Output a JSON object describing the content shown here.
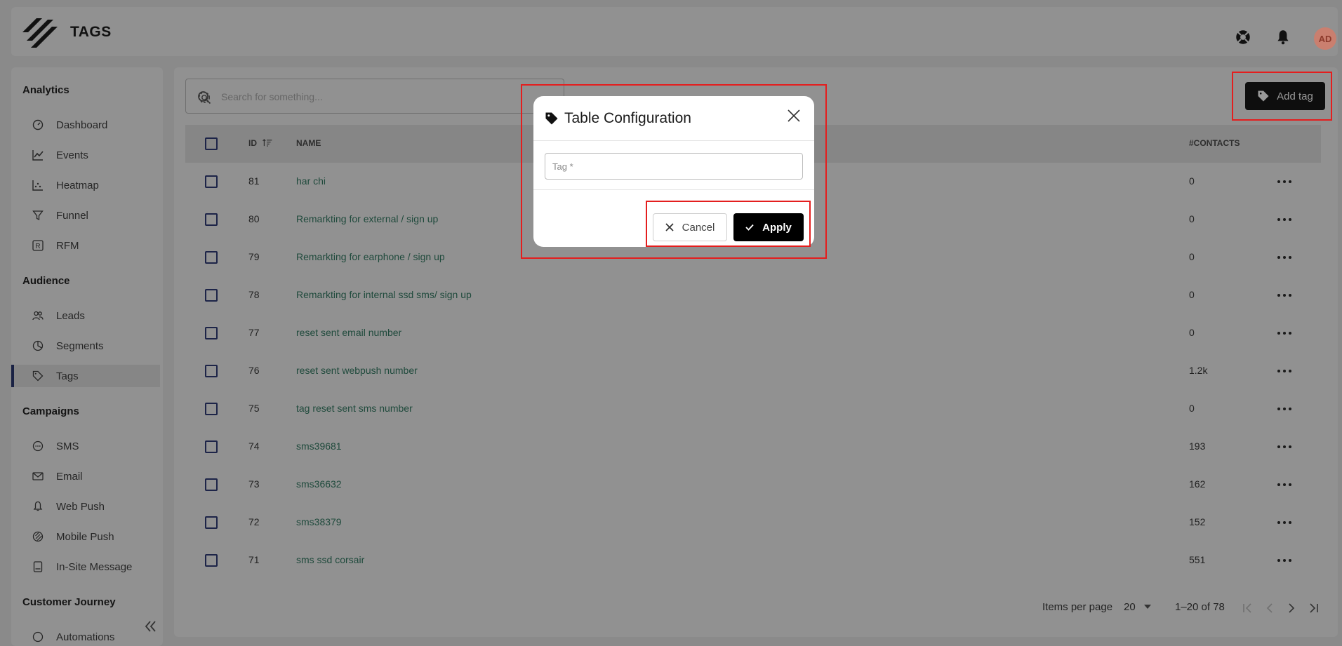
{
  "header": {
    "title": "TAGS",
    "user_initials": "AD"
  },
  "sidebar": {
    "sections": [
      {
        "title": "Analytics",
        "items": [
          {
            "label": "Dashboard",
            "icon": "dashboard-icon"
          },
          {
            "label": "Events",
            "icon": "chart-line-icon"
          },
          {
            "label": "Heatmap",
            "icon": "heatmap-icon"
          },
          {
            "label": "Funnel",
            "icon": "funnel-icon"
          },
          {
            "label": "RFM",
            "icon": "rfm-icon"
          }
        ]
      },
      {
        "title": "Audience",
        "items": [
          {
            "label": "Leads",
            "icon": "users-icon"
          },
          {
            "label": "Segments",
            "icon": "pie-chart-icon"
          },
          {
            "label": "Tags",
            "icon": "tag-icon",
            "active": true
          }
        ]
      },
      {
        "title": "Campaigns",
        "items": [
          {
            "label": "SMS",
            "icon": "sms-icon"
          },
          {
            "label": "Email",
            "icon": "email-icon"
          },
          {
            "label": "Web Push",
            "icon": "bell-icon"
          },
          {
            "label": "Mobile Push",
            "icon": "mobile-push-icon"
          },
          {
            "label": "In-Site Message",
            "icon": "in-site-message-icon"
          }
        ]
      },
      {
        "title": "Customer Journey",
        "items": [
          {
            "label": "Automations",
            "icon": "automation-icon"
          }
        ]
      }
    ]
  },
  "toolbar": {
    "search_placeholder": "Search for something...",
    "add_label": "Add tag"
  },
  "table": {
    "columns": {
      "id": "ID",
      "name": "NAME",
      "contacts": "#CONTACTS"
    },
    "rows": [
      {
        "id": "81",
        "name": "har chi",
        "contacts": "0"
      },
      {
        "id": "80",
        "name": "Remarkting for external / sign up",
        "contacts": "0"
      },
      {
        "id": "79",
        "name": "Remarkting for earphone / sign up",
        "contacts": "0"
      },
      {
        "id": "78",
        "name": "Remarkting for internal ssd sms/ sign up",
        "contacts": "0"
      },
      {
        "id": "77",
        "name": "reset sent email number",
        "contacts": "0"
      },
      {
        "id": "76",
        "name": "reset sent webpush number",
        "contacts": "1.2k"
      },
      {
        "id": "75",
        "name": "tag reset sent sms number",
        "contacts": "0"
      },
      {
        "id": "74",
        "name": "sms39681",
        "contacts": "193"
      },
      {
        "id": "73",
        "name": "sms36632",
        "contacts": "162"
      },
      {
        "id": "72",
        "name": "sms38379",
        "contacts": "152"
      },
      {
        "id": "71",
        "name": "sms ssd corsair",
        "contacts": "551"
      }
    ]
  },
  "pagination": {
    "items_label": "Items per page",
    "per_page": "20",
    "range": "1–20 of 78"
  },
  "modal": {
    "title": "Table Configuration",
    "field_placeholder": "Tag *",
    "cancel_label": "Cancel",
    "apply_label": "Apply"
  },
  "colors": {
    "accent": "#000000",
    "highlight": "#e41e1e",
    "link": "#1f4a3c",
    "avatar": "#ca7f6f"
  }
}
